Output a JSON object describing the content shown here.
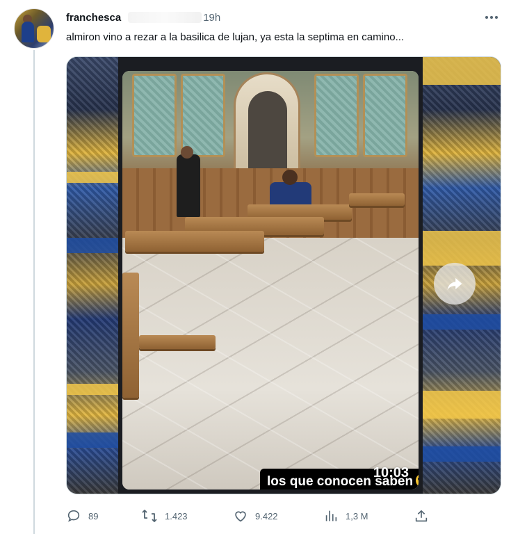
{
  "tweet": {
    "author_name": "franchesca",
    "time_ago": "19h",
    "text": "almiron vino a rezar a la basilica de lujan, ya esta la septima en camino...",
    "more_icon": "more-horizontal-icon"
  },
  "media": {
    "caption": "los que conocen saben",
    "caption_emoji": "sunglasses-emoji",
    "video_time": "10:03",
    "share_icon": "forward-arrow-icon",
    "colors": {
      "team_yellow": "#e0b43c",
      "team_blue": "#1f4ea3"
    }
  },
  "actions": {
    "replies": {
      "icon": "reply-icon",
      "count": "89"
    },
    "reposts": {
      "icon": "repost-icon",
      "count": "1.423"
    },
    "likes": {
      "icon": "heart-icon",
      "count": "9.422"
    },
    "views": {
      "icon": "views-icon",
      "count": "1,3 M"
    },
    "share": {
      "icon": "share-icon"
    }
  }
}
